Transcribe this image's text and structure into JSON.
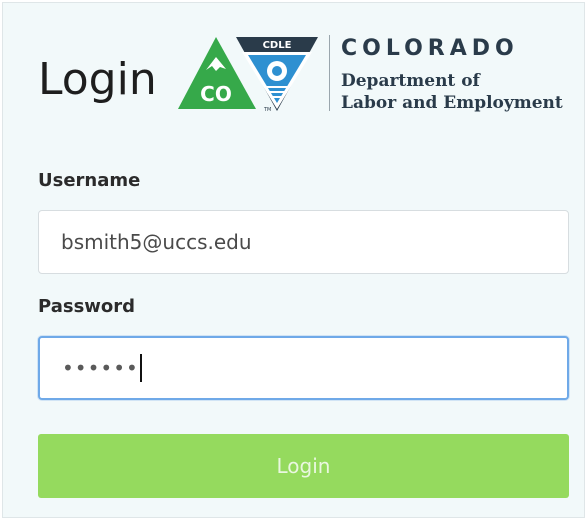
{
  "header": {
    "title": "Login"
  },
  "logo": {
    "badge_text": "CDLE",
    "co_text": "CO",
    "org_name": "COLORADO",
    "dept_line1": "Department of",
    "dept_line2": "Labor and Employment",
    "colors": {
      "green": "#36a94a",
      "navy": "#2a3b4a",
      "blue": "#2e90d1",
      "white": "#ffffff"
    }
  },
  "form": {
    "username_label": "Username",
    "username_value": "bsmith5@uccs.edu",
    "password_label": "Password",
    "password_masked": "••••••",
    "login_label": "Login"
  },
  "colors": {
    "panel_bg": "#f2f9fa",
    "button_bg": "#95da5e",
    "focus_border": "#6fa9e8"
  }
}
